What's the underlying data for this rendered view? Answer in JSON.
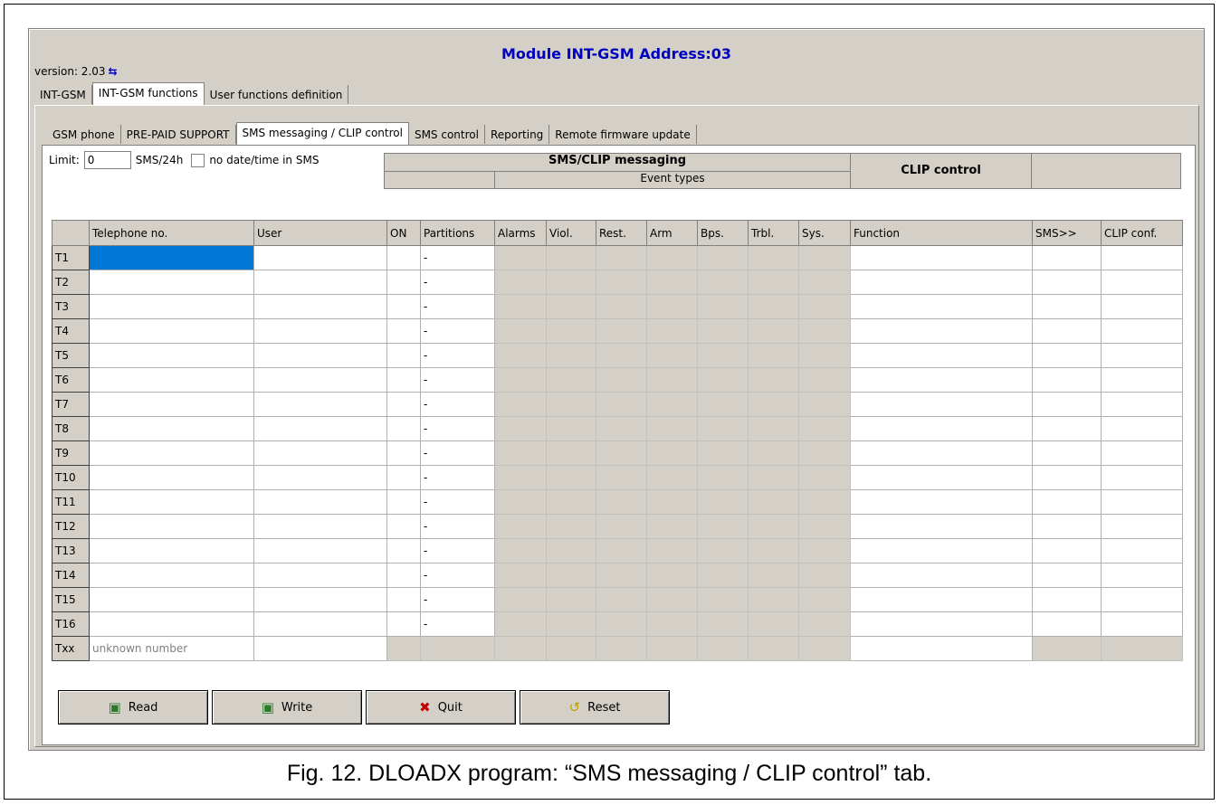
{
  "window": {
    "title": "Module INT-GSM Address:03",
    "version": "version: 2.03"
  },
  "main_tabs": [
    "INT-GSM",
    "INT-GSM functions",
    "User functions definition"
  ],
  "sub_tabs": [
    "GSM phone",
    "PRE-PAID SUPPORT",
    "SMS messaging / CLIP control",
    "SMS control",
    "Reporting",
    "Remote firmware update"
  ],
  "limit": {
    "label": "Limit:",
    "value": "0",
    "unit": "SMS/24h",
    "nodate_label": "no date/time in SMS"
  },
  "group_headers": {
    "sms_clip": "SMS/CLIP messaging",
    "event_types": "Event types",
    "clip_control": "CLIP control"
  },
  "columns": [
    "Telephone no.",
    "User",
    "ON",
    "Partitions",
    "Alarms",
    "Viol.",
    "Rest.",
    "Arm",
    "Bps.",
    "Trbl.",
    "Sys.",
    "Function",
    "SMS>>",
    "CLIP conf."
  ],
  "rows": [
    "T1",
    "T2",
    "T3",
    "T4",
    "T5",
    "T6",
    "T7",
    "T8",
    "T9",
    "T10",
    "T11",
    "T12",
    "T13",
    "T14",
    "T15",
    "T16"
  ],
  "partition_placeholder": "-",
  "txx_row": {
    "label": "Txx",
    "phone": "unknown number"
  },
  "buttons": {
    "read": "Read",
    "write": "Write",
    "quit": "Quit",
    "reset": "Reset"
  },
  "caption": "Fig. 12. DLOADX program: “SMS messaging / CLIP control” tab.",
  "colors": {
    "title": "#0000c0",
    "selection": "#0078d7",
    "panel": "#d4d0c8"
  }
}
